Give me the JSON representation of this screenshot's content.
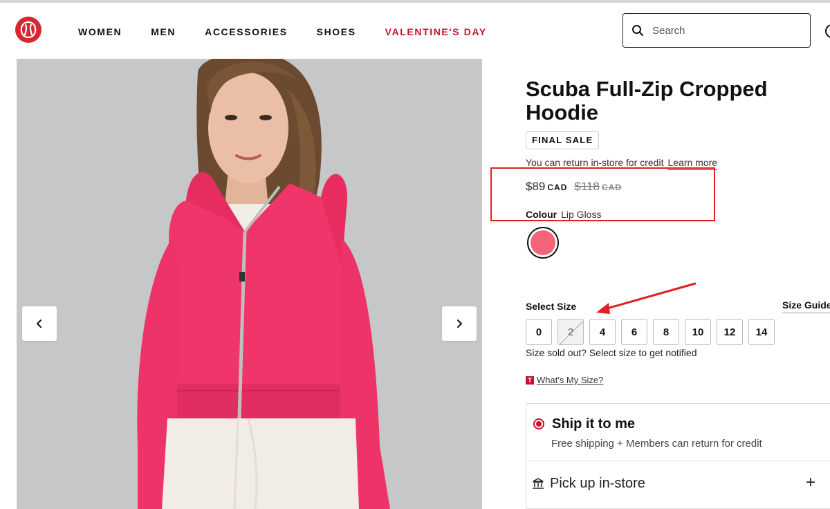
{
  "header": {
    "nav": [
      {
        "label": "WOMEN"
      },
      {
        "label": "MEN"
      },
      {
        "label": "ACCESSORIES"
      },
      {
        "label": "SHOES"
      },
      {
        "label": "VALENTINE'S DAY"
      }
    ],
    "search_placeholder": "Search"
  },
  "product": {
    "title": "Scuba Full-Zip Cropped Hoodie",
    "badge": "FINAL SALE",
    "return_text": "You can return in-store for credit",
    "learn_more": "Learn more",
    "price": "$89",
    "currency": "CAD",
    "original_price": "$118",
    "original_currency": "CAD",
    "colour_label": "Colour",
    "colour_value": "Lip Gloss",
    "swatch_color": "#f36478"
  },
  "sizes": {
    "label": "Select Size",
    "guide": "Size Guide",
    "options": [
      "0",
      "2",
      "4",
      "6",
      "8",
      "10",
      "12",
      "14"
    ],
    "sold_out": [
      "2"
    ],
    "sold_out_note": "Size sold out? Select size to get notified",
    "whats_my_size": "What's My Size?",
    "badge_letter": "T"
  },
  "fulfilment": {
    "ship_title": "Ship it to me",
    "ship_subtitle": "Free shipping + Members can return for credit",
    "pickup_label": "Pick up in-store",
    "expand_symbol": "+"
  },
  "colors": {
    "brand_red": "#d7282f",
    "accent": "#c8102e",
    "annotation": "#e02020",
    "hoodie": "#f0356a"
  }
}
